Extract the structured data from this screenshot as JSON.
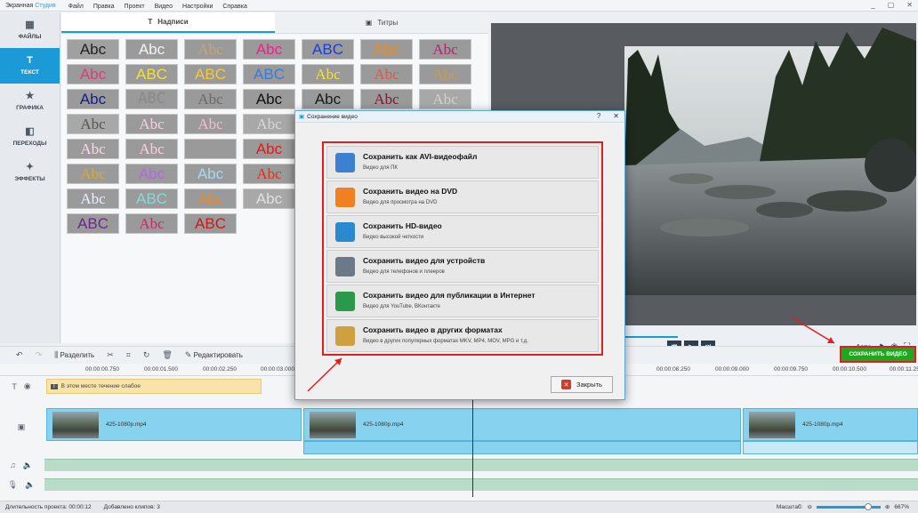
{
  "titlebar": {
    "app_name": "Экранная ",
    "app_name_accent": "Студия",
    "menu": [
      "Файл",
      "Правка",
      "Проект",
      "Видео",
      "Настройки",
      "Справка"
    ],
    "min": "_",
    "max": "▢",
    "close": "✕"
  },
  "sidebar": {
    "items": [
      {
        "label": "ФАЙЛЫ",
        "icon": "files-icon",
        "glyph": "▦"
      },
      {
        "label": "ТЕКСТ",
        "icon": "text-icon",
        "glyph": "T",
        "active": true
      },
      {
        "label": "ГРАФИКА",
        "icon": "star-icon",
        "glyph": "★"
      },
      {
        "label": "ПЕРЕХОДЫ",
        "icon": "transitions-icon",
        "glyph": "◧"
      },
      {
        "label": "ЭФФЕКТЫ",
        "icon": "magic-wand-icon",
        "glyph": "✦"
      }
    ]
  },
  "tabs": {
    "captions": "Надписи",
    "titles": "Титры"
  },
  "styles": {
    "rows": [
      [
        {
          "t": "Abc",
          "bg": "#a0a0a0",
          "c": "#222",
          "f": "\"Liberation Sans\""
        },
        {
          "t": "Abc",
          "bg": "#9a9a9a",
          "c": "#f4f4f4",
          "f": "\"Liberation Sans\""
        },
        {
          "t": "Abc",
          "bg": "#9a9a9a",
          "c": "#c8a47a",
          "f": "\"Liberation Serif\""
        },
        {
          "t": "Abc",
          "bg": "#9a9a9a",
          "c": "#f01e8a",
          "f": "\"Liberation Sans\""
        },
        {
          "t": "ABC",
          "bg": "#9a9a9a",
          "c": "#1a3dd8",
          "f": "\"Liberation Sans\""
        },
        {
          "t": "Abc",
          "bg": "#9a9a9a",
          "c": "#f08a1a",
          "f": "\"Liberation Sans\""
        },
        {
          "t": "Abc",
          "bg": "#9a9a9a",
          "c": "#b0286a",
          "f": "\"Liberation Serif\""
        }
      ],
      [
        {
          "t": "Abc",
          "bg": "#9a9a9a",
          "c": "#d83e7a",
          "f": "\"Liberation Sans\""
        },
        {
          "t": "ABC",
          "bg": "#9a9a9a",
          "c": "#f0e23a",
          "f": "\"Liberation Sans\""
        },
        {
          "t": "ABC",
          "bg": "#9a9a9a",
          "c": "#f8c83a",
          "f": "\"Liberation Sans\""
        },
        {
          "t": "ABC",
          "bg": "#9a9a9a",
          "c": "#3a7ae0",
          "f": "\"Liberation Sans\""
        },
        {
          "t": "Abc",
          "bg": "#9a9a9a",
          "c": "#f4e03a",
          "f": "\"Liberation Serif\""
        },
        {
          "t": "Abc",
          "bg": "#9a9a9a",
          "c": "#d85a4a",
          "f": "\"Liberation Serif\""
        },
        {
          "t": "Abc",
          "bg": "#9a9a9a",
          "c": "#c89a5a",
          "f": "\"Liberation Serif\""
        }
      ],
      [
        {
          "t": "Abc",
          "bg": "#9a9a9a",
          "c": "#1a1e7a",
          "f": "\"Liberation Sans\""
        },
        {
          "t": "ABC",
          "bg": "#9a9a9a",
          "c": "#8a8a8a",
          "f": "\"DejaVu Sans Mono\""
        },
        {
          "t": "Abc",
          "bg": "#9a9a9a",
          "c": "#6a6a6a",
          "f": "\"Liberation Serif\""
        },
        {
          "t": "Abc",
          "bg": "#9a9a9a",
          "c": "#111",
          "f": "\"Liberation Sans\""
        },
        {
          "t": "Abc",
          "bg": "#9a9a9a",
          "c": "#1a1a1a",
          "f": "\"Liberation Sans\""
        },
        {
          "t": "Abc",
          "bg": "#9a9a9a",
          "c": "#7a1a3a",
          "f": "\"Liberation Serif\""
        },
        {
          "t": "Abc",
          "bg": "#a8a8a8",
          "c": "#d0d0d0",
          "f": "\"Liberation Serif\""
        }
      ],
      [
        {
          "t": "Abc",
          "bg": "#a8a8a8",
          "c": "#555",
          "f": "\"Liberation Serif\""
        },
        {
          "t": "Abc",
          "bg": "#9a9a9a",
          "c": "#f4d0e0",
          "f": "\"Liberation Serif\""
        },
        {
          "t": "Abc",
          "bg": "#9a9a9a",
          "c": "#f0c0d0",
          "f": "\"Liberation Serif\""
        },
        {
          "t": "Abc",
          "bg": "#a8a8a8",
          "c": "#d8d8d8",
          "f": "\"Liberation Serif\""
        },
        {
          "t": "",
          "bg": "#9a9a9a",
          "c": "#222",
          "f": "\"Liberation Sans\""
        },
        {
          "t": "",
          "bg": "#9a9a9a",
          "c": "#222",
          "f": "\"Liberation Sans\""
        },
        {
          "t": "",
          "bg": "#9a9a9a",
          "c": "#222",
          "f": "\"Liberation Sans\""
        }
      ],
      [
        {
          "t": "Abc",
          "bg": "#9a9a9a",
          "c": "#f8d8e8",
          "f": "\"Liberation Serif\""
        },
        {
          "t": "Abc",
          "bg": "#9a9a9a",
          "c": "#f8d0e0",
          "f": "\"Liberation Serif\""
        },
        {
          "t": "",
          "bg": "#9a9a9a",
          "c": "#222",
          "f": "\"Liberation Sans\""
        },
        {
          "t": "Abc",
          "bg": "#9a9a9a",
          "c": "#e01a1a",
          "f": "\"Liberation Sans\""
        },
        {
          "t": "",
          "bg": "#9a9a9a",
          "c": "#222",
          "f": "\"Liberation Sans\""
        },
        {
          "t": "",
          "bg": "#9a9a9a",
          "c": "#222",
          "f": "\"Liberation Sans\""
        },
        {
          "t": "",
          "bg": "#9a9a9a",
          "c": "#222",
          "f": "\"Liberation Sans\""
        }
      ],
      [
        {
          "t": "Abc",
          "bg": "#9a9a9a",
          "c": "#d8a83a",
          "f": "\"Liberation Serif\""
        },
        {
          "t": "Abc",
          "bg": "#9a9a9a",
          "c": "#b06ae0",
          "f": "\"Liberation Sans\""
        },
        {
          "t": "Abc",
          "bg": "#9a9a9a",
          "c": "#a8d8f0",
          "f": "\"Liberation Sans\""
        },
        {
          "t": "Abc",
          "bg": "#9a9a9a",
          "c": "#e0301a",
          "f": "\"Liberation Serif\""
        },
        {
          "t": "",
          "bg": "#9a9a9a",
          "c": "#222",
          "f": "\"Liberation Sans\""
        },
        {
          "t": "",
          "bg": "#9a9a9a",
          "c": "#222",
          "f": "\"Liberation Sans\""
        },
        {
          "t": "",
          "bg": "#9a9a9a",
          "c": "#222",
          "f": "\"Liberation Sans\""
        }
      ],
      [
        {
          "t": "Abc",
          "bg": "#9a9a9a",
          "c": "#e8f0ff",
          "f": "\"Liberation Serif\""
        },
        {
          "t": "ABC",
          "bg": "#9a9a9a",
          "c": "#8ad8d8",
          "f": "\"Liberation Sans\""
        },
        {
          "t": "Abc",
          "bg": "#9a9a9a",
          "c": "#f08a1a",
          "f": "\"Liberation Serif\""
        },
        {
          "t": "Abc",
          "bg": "#a8a8a8",
          "c": "#e0e0e0",
          "f": "\"Liberation Sans\""
        },
        {
          "t": "",
          "bg": "#9a9a9a",
          "c": "#222",
          "f": "\"Liberation Sans\""
        },
        {
          "t": "",
          "bg": "#9a9a9a",
          "c": "#222",
          "f": "\"Liberation Sans\""
        },
        {
          "t": "",
          "bg": "#9a9a9a",
          "c": "#222",
          "f": "\"Liberation Sans\""
        }
      ],
      [
        {
          "t": "ABC",
          "bg": "#9a9a9a",
          "c": "#6a2a8a",
          "f": "\"Liberation Sans\""
        },
        {
          "t": "Abc",
          "bg": "#9a9a9a",
          "c": "#c82a6a",
          "f": "\"Liberation Serif\""
        },
        {
          "t": "ABC",
          "bg": "#9a9a9a",
          "c": "#c81a1a",
          "f": "\"Liberation Sans\""
        }
      ]
    ]
  },
  "preview": {
    "auto_label": "Авто",
    "save_button": "СОХРАНИТЬ ВИДЕО"
  },
  "toolbar": {
    "split": "Разделить",
    "edit": "Редактировать"
  },
  "ruler": {
    "ticks": [
      "00:00:00.750",
      "00:00:01.500",
      "00:00:02.250",
      "00:00:03.000",
      "00:00:08.250",
      "00:00:09.000",
      "00:00:09.750",
      "00:00:10.500",
      "00:00:11.250"
    ]
  },
  "timeline": {
    "text_clip": "В этом месте течение слабое",
    "clips": [
      "425-1080p.mp4",
      "425-1080p.mp4",
      "425-1080p.mp4"
    ]
  },
  "status": {
    "duration": "Длительность проекта:  00:00:12",
    "added": "Добавлено клипов: 3",
    "zoom_label": "Масштаб:",
    "zoom_value": "667%",
    "zoom_fraction": 0.85
  },
  "dialog": {
    "title": "Сохранение видео",
    "close": "Закрыть",
    "options": [
      {
        "title": "Сохранить как AVI-видеофайл",
        "desc": "Видео для ПК",
        "icon": "avi-file-icon",
        "color": "#3d7fd0"
      },
      {
        "title": "Сохранить видео на DVD",
        "desc": "Видео для просмотра на DVD",
        "icon": "dvd-disc-icon",
        "color": "#f08020"
      },
      {
        "title": "Сохранить HD-видео",
        "desc": "Видео высокой четкости",
        "icon": "hd-monitor-icon",
        "color": "#2a8ad0"
      },
      {
        "title": "Сохранить видео для устройств",
        "desc": "Видео для телефонов и плееров",
        "icon": "phone-icon",
        "color": "#6a7a88"
      },
      {
        "title": "Сохранить видео для публикации в Интернет",
        "desc": "Видео для YouTube, ВКонтакте",
        "icon": "globe-icon",
        "color": "#2a9a4a"
      },
      {
        "title": "Сохранить видео в других форматах",
        "desc": "Видео в других популярных форматах MKV, MP4, MOV, MPG и т.д.",
        "icon": "film-reel-icon",
        "color": "#d0a040"
      }
    ]
  },
  "colors": {
    "accent": "#1c9ad8",
    "save": "#1fa81f",
    "highlight": "#e02020"
  }
}
